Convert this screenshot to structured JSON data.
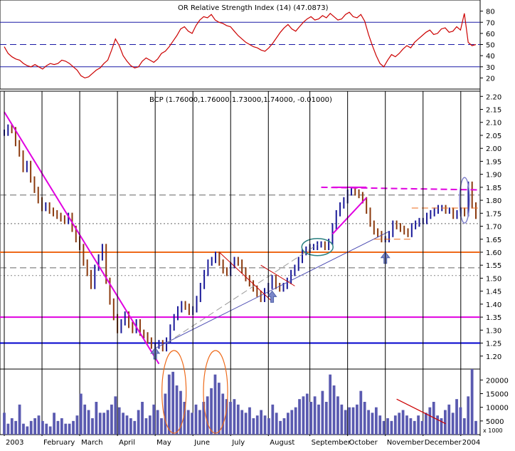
{
  "chart_data": [
    {
      "type": "line",
      "title": "OR Relative Strength Index (14) (47.0873)",
      "ylim": [
        10,
        90
      ],
      "yticks": [
        20,
        30,
        40,
        50,
        60,
        70,
        80
      ],
      "reference_lines": [
        {
          "value": 70,
          "style": "solid",
          "color": "#1a1aa6"
        },
        {
          "value": 50,
          "style": "dashed",
          "color": "#1a1aa6"
        },
        {
          "value": 30,
          "style": "solid",
          "color": "#1a1aa6"
        }
      ],
      "series": [
        {
          "color": "#cc0000",
          "values": [
            48,
            42,
            39,
            37,
            36,
            33,
            31,
            30,
            32,
            30,
            28,
            31,
            33,
            32,
            33,
            36,
            35,
            33,
            30,
            27,
            22,
            20,
            21,
            24,
            27,
            29,
            33,
            36,
            45,
            55,
            49,
            40,
            35,
            31,
            29,
            30,
            35,
            38,
            36,
            34,
            37,
            42,
            44,
            48,
            53,
            58,
            64,
            66,
            62,
            60,
            67,
            72,
            75,
            74,
            77,
            72,
            70,
            69,
            67,
            66,
            62,
            58,
            55,
            52,
            50,
            48,
            47,
            45,
            44,
            47,
            51,
            56,
            61,
            65,
            68,
            64,
            62,
            66,
            70,
            73,
            75,
            72,
            73,
            76,
            74,
            78,
            75,
            72,
            73,
            77,
            79,
            75,
            74,
            77,
            71,
            59,
            49,
            40,
            33,
            30,
            36,
            41,
            39,
            42,
            46,
            49,
            47,
            52,
            55,
            58,
            61,
            63,
            59,
            60,
            64,
            65,
            61,
            62,
            66,
            63,
            78,
            52,
            49,
            50
          ]
        }
      ]
    },
    {
      "type": "line",
      "title": "BCP (1.76000,1.76000,1.73000,1.74000, -0.01000)",
      "ylim": [
        1.15,
        2.22
      ],
      "yticks": [
        "1.20",
        "1.25",
        "1.30",
        "1.35",
        "1.40",
        "1.45",
        "1.50",
        "1.55",
        "1.60",
        "1.65",
        "1.70",
        "1.75",
        "1.80",
        "1.85",
        "1.90",
        "1.95",
        "2.00",
        "2.05",
        "2.10",
        "2.15",
        "2.20"
      ],
      "xticks": [
        "2003",
        "February",
        "March",
        "April",
        "May",
        "June",
        "July",
        "August",
        "September",
        "October",
        "November",
        "December",
        "2004"
      ],
      "horizontal_lines": [
        {
          "value": 1.25,
          "color": "#0000cc",
          "style": "solid"
        },
        {
          "value": 1.35,
          "color": "#e000e0",
          "style": "solid"
        },
        {
          "value": 1.51,
          "color": "#888888",
          "style": "dotted"
        },
        {
          "value": 1.54,
          "color": "#666666",
          "style": "dashed"
        },
        {
          "value": 1.6,
          "color": "#ee6a1a",
          "style": "solid"
        },
        {
          "value": 1.71,
          "color": "#666666",
          "style": "dotted"
        },
        {
          "value": 1.82,
          "color": "#666666",
          "style": "dashed"
        }
      ],
      "series": [
        {
          "name": "BCP",
          "color": "#1a1a99",
          "values": [
            2.06,
            2.08,
            2.07,
            2.02,
            1.98,
            1.92,
            1.94,
            1.88,
            1.84,
            1.8,
            1.77,
            1.78,
            1.76,
            1.75,
            1.74,
            1.73,
            1.72,
            1.74,
            1.69,
            1.65,
            1.62,
            1.56,
            1.52,
            1.47,
            1.54,
            1.58,
            1.62,
            1.49,
            1.41,
            1.35,
            1.3,
            1.33,
            1.36,
            1.32,
            1.3,
            1.33,
            1.29,
            1.28,
            1.26,
            1.24,
            1.24,
            1.25,
            1.23,
            1.26,
            1.31,
            1.35,
            1.38,
            1.4,
            1.39,
            1.37,
            1.38,
            1.42,
            1.47,
            1.52,
            1.56,
            1.57,
            1.59,
            1.56,
            1.53,
            1.52,
            1.55,
            1.57,
            1.56,
            1.53,
            1.5,
            1.48,
            1.46,
            1.44,
            1.42,
            1.45,
            1.47,
            1.5,
            1.47,
            1.46,
            1.47,
            1.49,
            1.52,
            1.54,
            1.57,
            1.6,
            1.61,
            1.62,
            1.62,
            1.63,
            1.63,
            1.62,
            1.64,
            1.7,
            1.75,
            1.78,
            1.8,
            1.83,
            1.84,
            1.83,
            1.82,
            1.8,
            1.76,
            1.71,
            1.68,
            1.67,
            1.65,
            1.65,
            1.67,
            1.71,
            1.7,
            1.69,
            1.68,
            1.67,
            1.7,
            1.71,
            1.72,
            1.72,
            1.74,
            1.75,
            1.76,
            1.77,
            1.77,
            1.76,
            1.76,
            1.74,
            1.75,
            1.76,
            1.75,
            1.86,
            1.78,
            1.74
          ]
        }
      ],
      "trendlines": [
        {
          "from": [
            0,
            2.14
          ],
          "to": [
            41,
            1.17
          ],
          "color": "#e000e0"
        },
        {
          "from": [
            40,
            1.23
          ],
          "to": [
            102,
            1.68
          ],
          "color": "#4d4db3"
        },
        {
          "from": [
            43,
            1.25
          ],
          "to": [
            83,
            1.63
          ],
          "color": "#999999",
          "style": "dashed"
        },
        {
          "from": [
            57,
            1.6
          ],
          "to": [
            71,
            1.41
          ],
          "color": "#cc0000"
        },
        {
          "from": [
            68,
            1.55
          ],
          "to": [
            77,
            1.47
          ],
          "color": "#cc0000"
        },
        {
          "from": [
            87,
            1.67
          ],
          "to": [
            96,
            1.81
          ],
          "color": "#e000e0"
        },
        {
          "from": [
            87,
            1.85
          ],
          "to": [
            96,
            1.85
          ],
          "color": "#e000e0"
        },
        {
          "from": [
            84,
            1.85
          ],
          "to": [
            126,
            1.84
          ],
          "color": "#e000e0",
          "style": "dashed"
        },
        {
          "from": [
            98,
            1.65
          ],
          "to": [
            108,
            1.65
          ],
          "color": "#ee6a1a",
          "style": "dashed"
        },
        {
          "from": [
            108,
            1.77
          ],
          "to": [
            126,
            1.77
          ],
          "color": "#ee6a1a",
          "style": "dashed"
        }
      ],
      "arrows_at": [
        40,
        71,
        101
      ],
      "ellipses": [
        {
          "center_index": 83,
          "value": 1.62,
          "color": "#2a8080"
        },
        {
          "center_index": 122,
          "value": 1.8,
          "color": "#8080cc"
        }
      ]
    },
    {
      "type": "bar",
      "title": "Volume",
      "ylim": [
        0,
        24000
      ],
      "yticks": [
        "5000",
        "10000",
        "15000",
        "20000"
      ],
      "scale_note": "x 1000",
      "color": "#5a5ab0",
      "series": [
        {
          "values": [
            8,
            4,
            6,
            5,
            11,
            4,
            3,
            5,
            6,
            7,
            5,
            4,
            3,
            8,
            5,
            6,
            4,
            4,
            5,
            7,
            15,
            11,
            9,
            6,
            12,
            8,
            8,
            9,
            11,
            14,
            10,
            8,
            7,
            6,
            5,
            9,
            12,
            6,
            7,
            11,
            9,
            6,
            15,
            22,
            23,
            18,
            16,
            12,
            9,
            8,
            11,
            9,
            12,
            14,
            17,
            22,
            19,
            15,
            13,
            12,
            13,
            11,
            9,
            8,
            10,
            6,
            7,
            9,
            7,
            6,
            11,
            8,
            5,
            6,
            8,
            9,
            10,
            13,
            14,
            15,
            12,
            14,
            11,
            16,
            12,
            22,
            18,
            14,
            11,
            9,
            10,
            10,
            11,
            16,
            12,
            9,
            8,
            10,
            7,
            5,
            6,
            5,
            7,
            8,
            9,
            7,
            6,
            5,
            7,
            5,
            8,
            10,
            12,
            7,
            6,
            9,
            11,
            8,
            13,
            10,
            6,
            14,
            24,
            5
          ]
        }
      ],
      "annotations": [
        {
          "type": "ellipse",
          "around_index": 45,
          "color": "#ee6a1a"
        },
        {
          "type": "ellipse",
          "around_index": 56,
          "color": "#ee6a1a"
        },
        {
          "type": "trendline",
          "from": [
            104,
            13000
          ],
          "to": [
            117,
            4000
          ],
          "color": "#cc0000"
        }
      ]
    }
  ]
}
